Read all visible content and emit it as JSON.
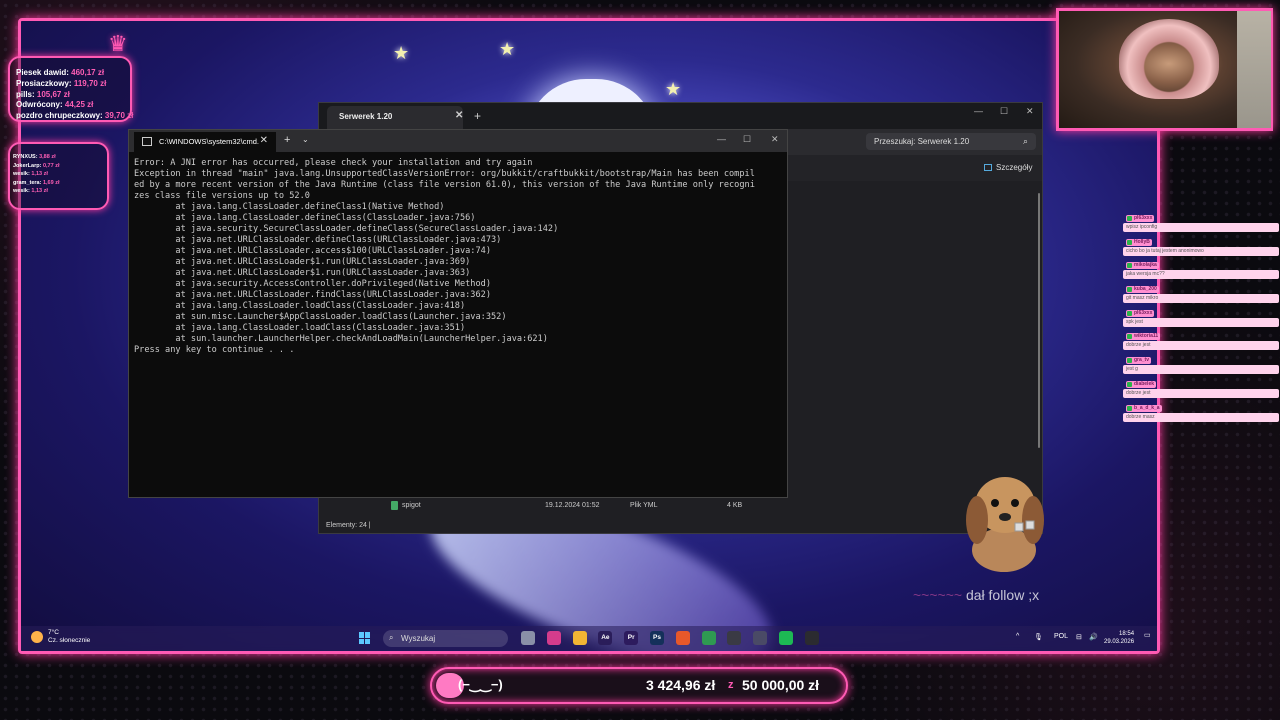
{
  "donations_top": [
    {
      "name": "Piesek dawid:",
      "amount": "460,17 zł"
    },
    {
      "name": "Prosiaczkowy:",
      "amount": "119,70 zł"
    },
    {
      "name": "pills:",
      "amount": "105,67 zł"
    },
    {
      "name": "Odwrócony:",
      "amount": "44,25 zł"
    },
    {
      "name": "pozdro chrupeczkowy:",
      "amount": "39,70 zł"
    }
  ],
  "donations_recent": [
    {
      "name": "RYNXUS:",
      "amount": "3,88 zł"
    },
    {
      "name": "JokerLarp:",
      "amount": "0,77 zł"
    },
    {
      "name": "wesik:",
      "amount": "1,13 zł"
    },
    {
      "name": "gram_tera:",
      "amount": "1,69 zł"
    },
    {
      "name": "wesik:",
      "amount": "1,13 zł"
    }
  ],
  "explorer": {
    "tab_title": "Serwerek 1.20",
    "search_placeholder": "Przeszukaj: Serwerek 1.20",
    "details_label": "Szczegóły",
    "file": {
      "name": "spigot",
      "date": "19.12.2024 01:52",
      "type": "Plik YML",
      "size": "4 KB"
    },
    "status": "Elementy: 24"
  },
  "cmd": {
    "tab_title": "C:\\WINDOWS\\system32\\cmd.",
    "lines": [
      "Error: A JNI error has occurred, please check your installation and try again",
      "Exception in thread \"main\" java.lang.UnsupportedClassVersionError: org/bukkit/craftbukkit/bootstrap/Main has been compil",
      "ed by a more recent version of the Java Runtime (class file version 61.0), this version of the Java Runtime only recogni",
      "zes class file versions up to 52.0",
      "        at java.lang.ClassLoader.defineClass1(Native Method)",
      "        at java.lang.ClassLoader.defineClass(ClassLoader.java:756)",
      "        at java.security.SecureClassLoader.defineClass(SecureClassLoader.java:142)",
      "        at java.net.URLClassLoader.defineClass(URLClassLoader.java:473)",
      "        at java.net.URLClassLoader.access$100(URLClassLoader.java:74)",
      "        at java.net.URLClassLoader$1.run(URLClassLoader.java:369)",
      "        at java.net.URLClassLoader$1.run(URLClassLoader.java:363)",
      "        at java.security.AccessController.doPrivileged(Native Method)",
      "        at java.net.URLClassLoader.findClass(URLClassLoader.java:362)",
      "        at java.lang.ClassLoader.loadClass(ClassLoader.java:418)",
      "        at sun.misc.Launcher$AppClassLoader.loadClass(Launcher.java:352)",
      "        at java.lang.ClassLoader.loadClass(ClassLoader.java:351)",
      "        at sun.launcher.LauncherHelper.checkAndLoadMain(LauncherHelper.java:621)",
      "Press any key to continue . . ."
    ]
  },
  "taskbar": {
    "weather_temp": "7°C",
    "weather_desc": "Cz. słonecznie",
    "search_placeholder": "Wyszukaj",
    "apps": [
      {
        "name": "task-view",
        "label": "",
        "color": "#8a8fa8"
      },
      {
        "name": "app-pink",
        "label": "",
        "color": "#d43c8c"
      },
      {
        "name": "file-explorer",
        "label": "",
        "color": "#f2b534"
      },
      {
        "name": "after-effects",
        "label": "Ae",
        "color": "#2a1d5a"
      },
      {
        "name": "premiere",
        "label": "Pr",
        "color": "#2d1b5e"
      },
      {
        "name": "photoshop",
        "label": "Ps",
        "color": "#14305a"
      },
      {
        "name": "brave",
        "label": "",
        "color": "#e8582a"
      },
      {
        "name": "chrome",
        "label": "",
        "color": "#2f9a52"
      },
      {
        "name": "obs",
        "label": "",
        "color": "#3a3a44"
      },
      {
        "name": "discord",
        "label": "",
        "color": "#4a4a66"
      },
      {
        "name": "spotify",
        "label": "",
        "color": "#1db954"
      },
      {
        "name": "terminal",
        "label": "",
        "color": "#2b2b30"
      }
    ],
    "language": "POL",
    "time": "18:54",
    "date": "29.03.2026"
  },
  "chat": [
    {
      "nick": "pl63xxx",
      "text": "wpisz ipconfig"
    },
    {
      "nick": "HollyB",
      "text": "cicho bo ja tutaj jestem anonimowo"
    },
    {
      "nick": "mikolajka",
      "text": "jaka wersja mc??"
    },
    {
      "nick": "kuba_200",
      "text": "git masz mikro"
    },
    {
      "nick": "pl63xxx",
      "text": "spk jest"
    },
    {
      "nick": "wiktoria11",
      "text": "dobrze jest"
    },
    {
      "nick": "gra_tv",
      "text": "jest g"
    },
    {
      "nick": "diabelek",
      "text": "dobrze jest"
    },
    {
      "nick": "b_a_d_k_a",
      "text": "dobrze masz"
    }
  ],
  "follow_text": "dał follow ;x",
  "goal": {
    "face": "(−‿‿−)",
    "current": "3 424,96 zł",
    "separator": "z",
    "target": "50 000,00 zł",
    "progress": 0.068
  },
  "colors": {
    "accent": "#ff5ab4",
    "donation_amount": "#ff5fb5",
    "chat_bubble": "#ffd3ec"
  }
}
